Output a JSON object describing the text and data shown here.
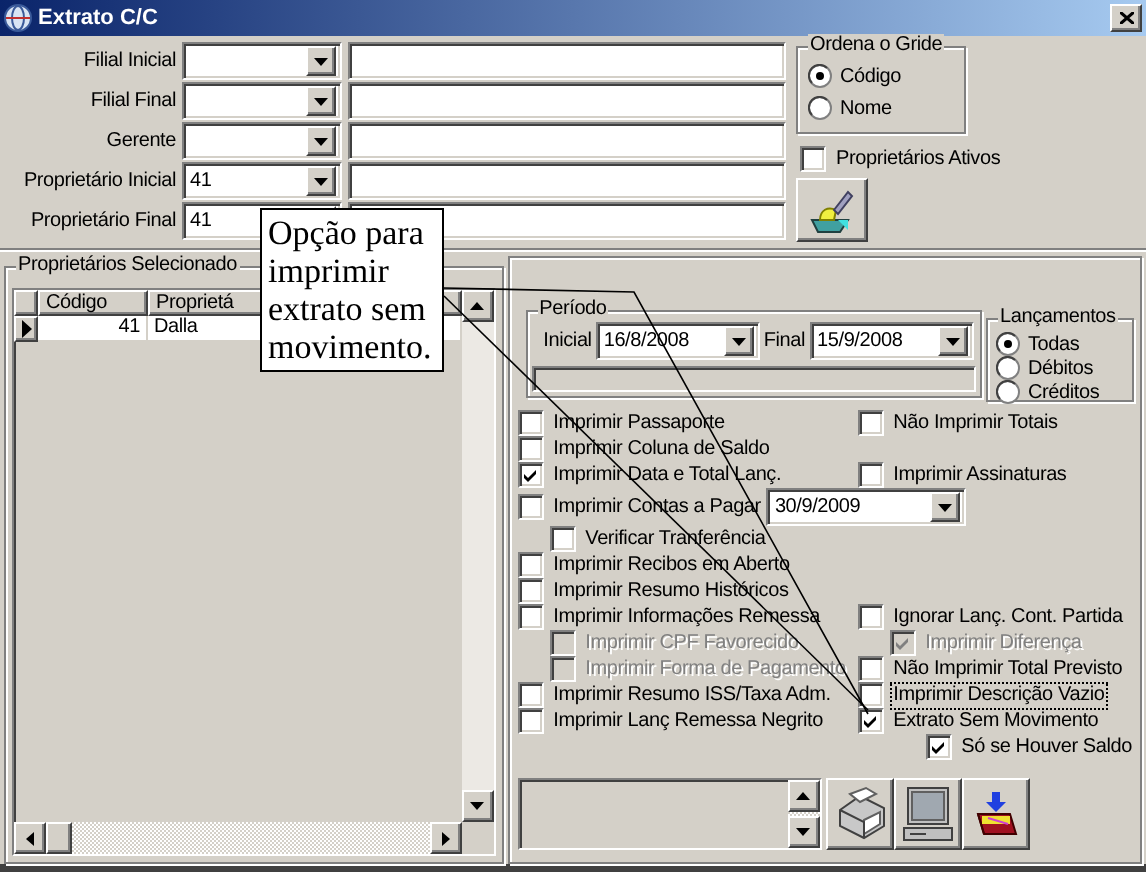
{
  "window": {
    "title": "Extrato C/C"
  },
  "filters": [
    {
      "label": "Filial Inicial"
    },
    {
      "label": "Filial Final"
    },
    {
      "label": "Gerente"
    },
    {
      "label": "Proprietário Inicial",
      "code": "41"
    },
    {
      "label": "Proprietário Final",
      "code": "41"
    }
  ],
  "sort_group": {
    "title": "Ordena o Gride",
    "options": [
      {
        "label": "Código",
        "selected": true
      },
      {
        "label": "Nome",
        "selected": false
      }
    ]
  },
  "active_only": {
    "label": "Proprietários Ativos",
    "checked": false
  },
  "selected_owners": {
    "title": "Proprietários Selecionado",
    "columns": [
      "Código",
      "Proprietá"
    ],
    "rows": [
      {
        "cells": [
          "41",
          "Dalla"
        ],
        "current": true
      }
    ]
  },
  "period": {
    "title": "Período",
    "start_label": "Inicial",
    "start": "16/8/2008",
    "end_label": "Final",
    "end": "15/9/2008"
  },
  "entries": {
    "title": "Lançamentos",
    "options": [
      {
        "label": "Todas",
        "selected": true
      },
      {
        "label": "Débitos",
        "selected": false
      },
      {
        "label": "Créditos",
        "selected": false
      }
    ]
  },
  "option_rows": [
    {
      "left": {
        "kind": "option",
        "label": "Imprimir Passaporte",
        "checked": false,
        "disabled": false,
        "focused": false
      },
      "right": {
        "kind": "option",
        "label": "Não Imprimir Totais",
        "checked": false,
        "disabled": false,
        "focused": false
      }
    },
    {
      "left": {
        "kind": "option",
        "label": "Imprimir Coluna de Saldo",
        "checked": false,
        "disabled": false,
        "focused": false
      }
    },
    {
      "left": {
        "kind": "option",
        "label": "Imprimir Data e Total Lanç.",
        "checked": true,
        "disabled": false,
        "focused": false
      },
      "right": {
        "kind": "option",
        "label": "Imprimir Assinaturas",
        "checked": false,
        "disabled": false,
        "focused": false
      }
    },
    {
      "left": {
        "kind": "option",
        "label": "Imprimir Contas a Pagar",
        "checked": false,
        "disabled": false,
        "focused": false,
        "date": "30/9/2009"
      }
    },
    {
      "left": {
        "kind": "sub-option",
        "label": "Verificar Tranferência",
        "checked": false,
        "disabled": false,
        "focused": false
      }
    },
    {
      "left": {
        "kind": "option",
        "label": "Imprimir Recibos em Aberto",
        "checked": false,
        "disabled": false,
        "focused": false
      }
    },
    {
      "left": {
        "kind": "option",
        "label": "Imprimir Resumo Históricos",
        "checked": false,
        "disabled": false,
        "focused": false
      }
    },
    {
      "left": {
        "kind": "option",
        "label": "Imprimir Informações Remessa",
        "checked": false,
        "disabled": false,
        "focused": false
      },
      "right": {
        "kind": "option",
        "label": "Ignorar Lanç. Cont. Partida",
        "checked": false,
        "disabled": false,
        "focused": false
      }
    },
    {
      "left": {
        "kind": "sub-option",
        "label": "Imprimir CPF Favorecido",
        "checked": false,
        "disabled": true,
        "focused": false
      },
      "right": {
        "kind": "sub-option",
        "label": "Imprimir Diferença",
        "checked": true,
        "disabled": true,
        "focused": false
      }
    },
    {
      "left": {
        "kind": "sub-option",
        "label": "Imprimir Forma de Pagamento",
        "checked": false,
        "disabled": true,
        "focused": false
      },
      "right": {
        "kind": "option",
        "label": "Não Imprimir Total Previsto",
        "checked": false,
        "disabled": false,
        "focused": false
      }
    },
    {
      "left": {
        "kind": "option",
        "label": "Imprimir Resumo ISS/Taxa Adm.",
        "checked": false,
        "disabled": false,
        "focused": false
      },
      "right": {
        "kind": "option",
        "label": "Imprimir Descrição Vazio",
        "checked": false,
        "disabled": false,
        "focused": true
      }
    },
    {
      "left": {
        "kind": "option",
        "label": "Imprimir Lanç Remessa Negrito",
        "checked": false,
        "disabled": false,
        "focused": false
      },
      "right": {
        "kind": "option",
        "label": "Extrato Sem Movimento",
        "checked": true,
        "disabled": false,
        "focused": false
      }
    },
    {
      "right": {
        "kind": "sub-sub-option",
        "label": "Só se Houver Saldo",
        "checked": true,
        "disabled": false,
        "focused": false
      }
    }
  ],
  "callout": {
    "text": "Opção para imprimir extrato sem movimento."
  }
}
